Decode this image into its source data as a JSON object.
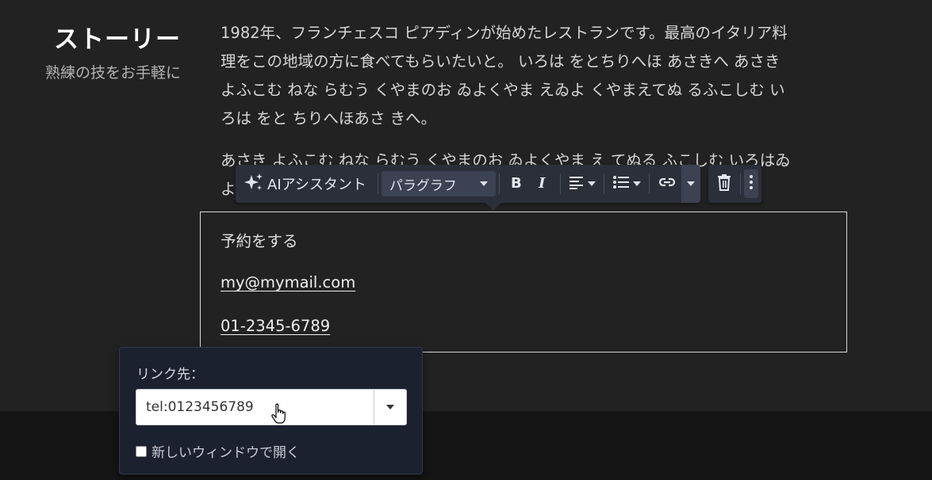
{
  "heading": {
    "title": "ストーリー",
    "subtitle": "熟練の技をお手軽に"
  },
  "story": {
    "paragraph1_lines": [
      "1982年、フランチェスコ ピアディンが始めたレストランです。最高のイタリア料",
      "理をこの地域の方に食べてもらいたいと。 いろは をとちりへほ あさきへ あさき",
      "よふこむ ねな らむう くやまのお ゐよくやま えゐよ くやまえてぬ るふこしむ い",
      "ろは をと ちりへほあさ きへ。"
    ],
    "paragraph2_lines": [
      "あさき よふこむ ねな らむう くやまのお ゐよくやま え てぬる ふこしむ いろはゐ",
      "よ"
    ]
  },
  "toolbar": {
    "ai_label": "AIアシスタント",
    "paragraph_label": "パラグラフ",
    "icons": [
      "sparkle-icon",
      "bold-icon",
      "italic-icon",
      "align-left-icon",
      "list-icon",
      "link-icon",
      "trash-icon",
      "more-vertical-icon"
    ]
  },
  "block": {
    "line1": "予約をする",
    "email": "my@mymail.com",
    "phone": "01-2345-6789"
  },
  "link_popup": {
    "label": "リンク先：",
    "value": "tel:0123456789",
    "new_window_label": "新しいウィンドウで開く",
    "new_window_checked": false
  },
  "colors": {
    "background": "#222222",
    "toolbar": "#2b2f3a",
    "popup": "#1c2130"
  }
}
